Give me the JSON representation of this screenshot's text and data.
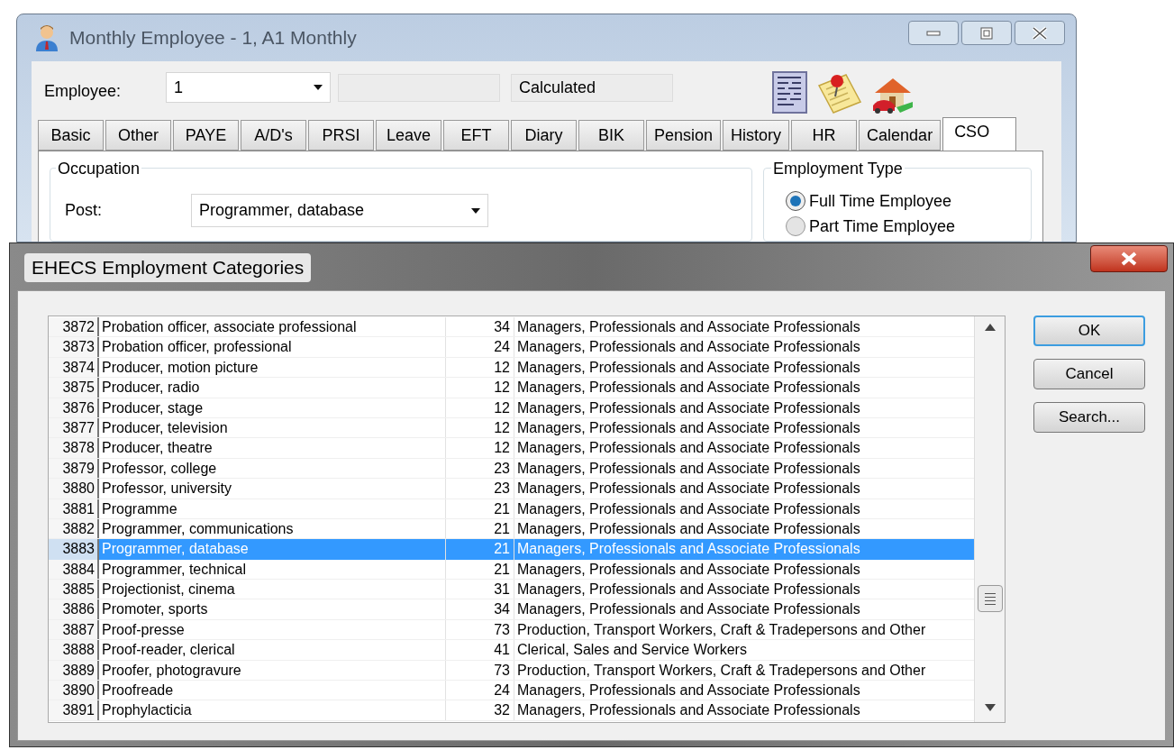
{
  "employee_window": {
    "title": "Monthly Employee - 1, A1 Monthly",
    "employee_label": "Employee:",
    "employee_value": "1",
    "status": "Calculated",
    "tabs": [
      {
        "label": "Basic",
        "selected": false
      },
      {
        "label": "Other",
        "selected": false
      },
      {
        "label": "PAYE",
        "selected": false
      },
      {
        "label": "A/D's",
        "selected": false
      },
      {
        "label": "PRSI",
        "selected": false
      },
      {
        "label": "Leave",
        "selected": false
      },
      {
        "label": "EFT",
        "selected": false
      },
      {
        "label": "Diary",
        "selected": false
      },
      {
        "label": "BIK",
        "selected": false
      },
      {
        "label": "Pension",
        "selected": false
      },
      {
        "label": "History",
        "selected": false
      },
      {
        "label": "HR",
        "selected": false
      },
      {
        "label": "Calendar",
        "selected": false
      },
      {
        "label": "CSO",
        "selected": true
      }
    ],
    "occupation": {
      "title": "Occupation",
      "post_label": "Post:",
      "post_value": "Programmer, database"
    },
    "employment_type": {
      "title": "Employment Type",
      "options": [
        {
          "label": "Full Time Employee",
          "selected": true
        },
        {
          "label": "Part Time Employee",
          "selected": false
        }
      ]
    }
  },
  "dialog": {
    "title": "EHECS Employment Categories",
    "rows": [
      {
        "code": "3872",
        "name": "Probation officer, associate professional",
        "number": "34",
        "category": "Managers, Professionals and Associate Professionals",
        "selected": false
      },
      {
        "code": "3873",
        "name": "Probation officer, professional",
        "number": "24",
        "category": "Managers, Professionals and Associate Professionals",
        "selected": false
      },
      {
        "code": "3874",
        "name": "Producer, motion picture",
        "number": "12",
        "category": "Managers, Professionals and Associate Professionals",
        "selected": false
      },
      {
        "code": "3875",
        "name": "Producer, radio",
        "number": "12",
        "category": "Managers, Professionals and Associate Professionals",
        "selected": false
      },
      {
        "code": "3876",
        "name": "Producer, stage",
        "number": "12",
        "category": "Managers, Professionals and Associate Professionals",
        "selected": false
      },
      {
        "code": "3877",
        "name": "Producer, television",
        "number": "12",
        "category": "Managers, Professionals and Associate Professionals",
        "selected": false
      },
      {
        "code": "3878",
        "name": "Producer, theatre",
        "number": "12",
        "category": "Managers, Professionals and Associate Professionals",
        "selected": false
      },
      {
        "code": "3879",
        "name": "Professor, college",
        "number": "23",
        "category": "Managers, Professionals and Associate Professionals",
        "selected": false
      },
      {
        "code": "3880",
        "name": "Professor, university",
        "number": "23",
        "category": "Managers, Professionals and Associate Professionals",
        "selected": false
      },
      {
        "code": "3881",
        "name": "Programme",
        "number": "21",
        "category": "Managers, Professionals and Associate Professionals",
        "selected": false
      },
      {
        "code": "3882",
        "name": "Programmer, communications",
        "number": "21",
        "category": "Managers, Professionals and Associate Professionals",
        "selected": false
      },
      {
        "code": "3883",
        "name": "Programmer, database",
        "number": "21",
        "category": "Managers, Professionals and Associate Professionals",
        "selected": true
      },
      {
        "code": "3884",
        "name": "Programmer, technical",
        "number": "21",
        "category": "Managers, Professionals and Associate Professionals",
        "selected": false
      },
      {
        "code": "3885",
        "name": "Projectionist, cinema",
        "number": "31",
        "category": "Managers, Professionals and Associate Professionals",
        "selected": false
      },
      {
        "code": "3886",
        "name": "Promoter, sports",
        "number": "34",
        "category": "Managers, Professionals and Associate Professionals",
        "selected": false
      },
      {
        "code": "3887",
        "name": "Proof-presse",
        "number": "73",
        "category": "Production, Transport Workers, Craft & Tradepersons and Other",
        "selected": false
      },
      {
        "code": "3888",
        "name": "Proof-reader, clerical",
        "number": "41",
        "category": "Clerical, Sales and Service Workers",
        "selected": false
      },
      {
        "code": "3889",
        "name": "Proofer, photogravure",
        "number": "73",
        "category": "Production, Transport Workers, Craft & Tradepersons and Other",
        "selected": false
      },
      {
        "code": "3890",
        "name": "Proofreade",
        "number": "24",
        "category": "Managers, Professionals and Associate Professionals",
        "selected": false
      },
      {
        "code": "3891",
        "name": "Prophylacticia",
        "number": "32",
        "category": "Managers, Professionals and Associate Professionals",
        "selected": false
      }
    ],
    "buttons": [
      {
        "label": "OK",
        "default": true
      },
      {
        "label": "Cancel",
        "default": false
      },
      {
        "label": "Search...",
        "default": false
      }
    ]
  }
}
